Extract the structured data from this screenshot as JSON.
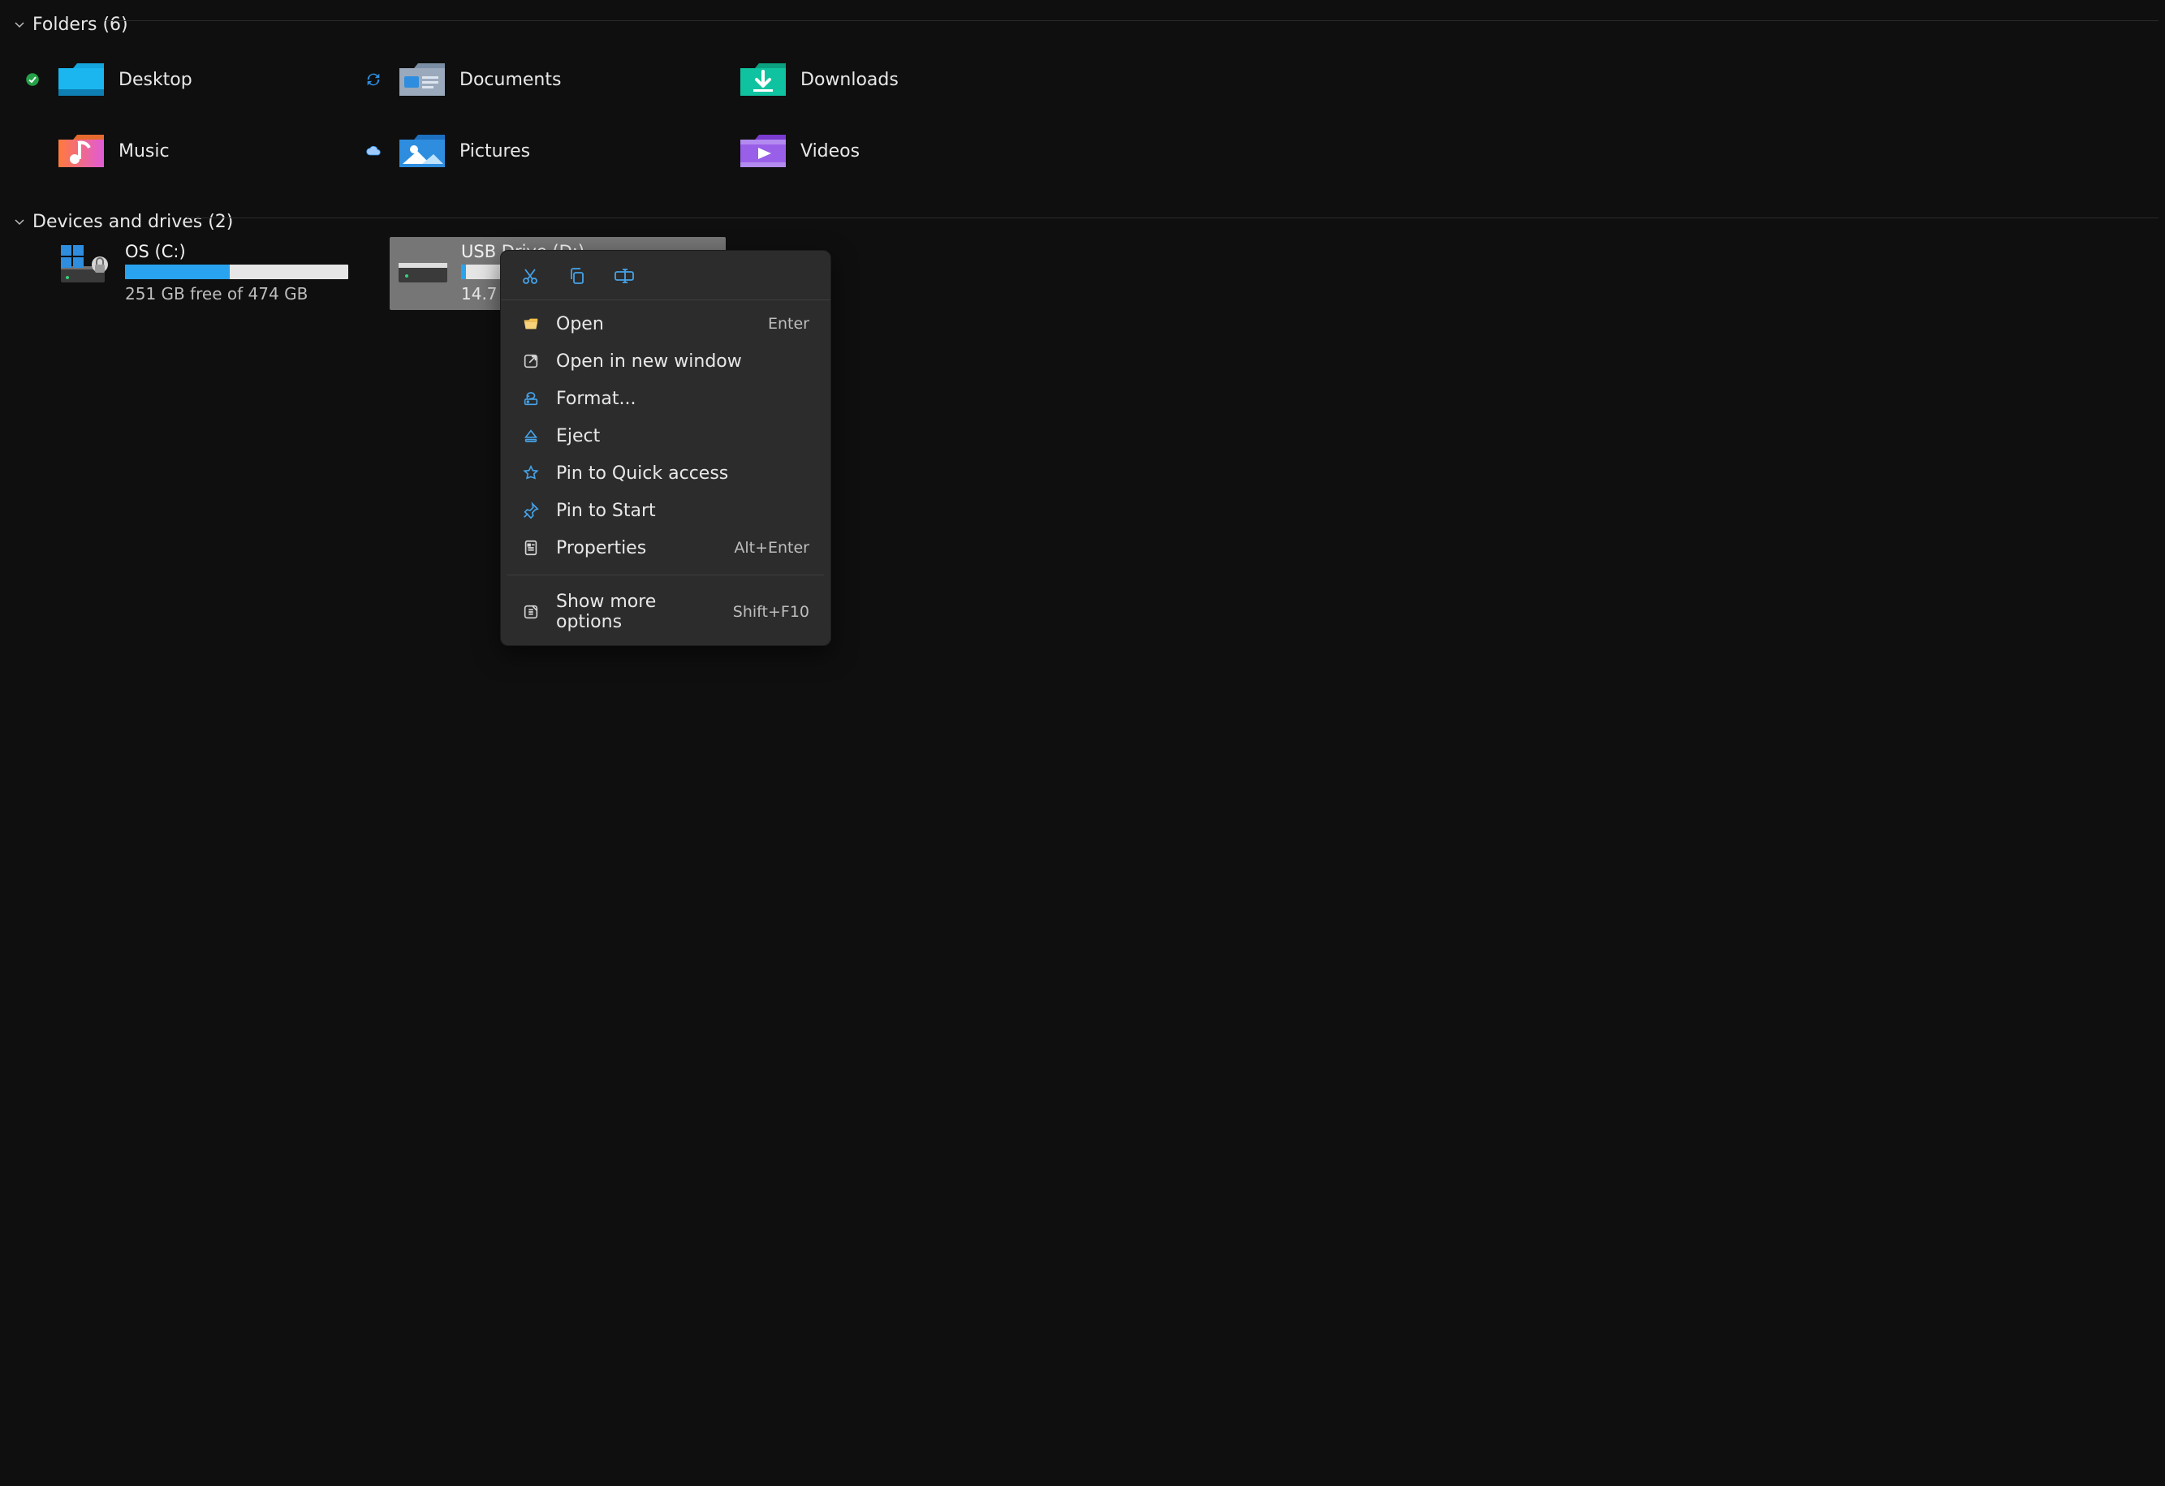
{
  "colors": {
    "accent": "#1c9bf0"
  },
  "groups": {
    "folders": {
      "title": "Folders (6)"
    },
    "drives": {
      "title": "Devices and drives (2)"
    }
  },
  "folders": [
    {
      "label": "Desktop",
      "status": "synced"
    },
    {
      "label": "Documents",
      "status": "syncing"
    },
    {
      "label": "Downloads",
      "status": "none"
    },
    {
      "label": "Music",
      "status": "none"
    },
    {
      "label": "Pictures",
      "status": "cloud"
    },
    {
      "label": "Videos",
      "status": "none"
    }
  ],
  "drives": [
    {
      "title": "OS (C:)",
      "sub": "251 GB free of 474 GB",
      "fill_pct": 47,
      "selected": false,
      "kind": "os"
    },
    {
      "title": "USB Drive (D:)",
      "sub": "14.7",
      "fill_pct": 2,
      "selected": true,
      "kind": "usb"
    }
  ],
  "context_menu": {
    "quick_actions": [
      "cut",
      "copy",
      "rename"
    ],
    "items": [
      {
        "icon": "folder-open",
        "label": "Open",
        "accel": "Enter"
      },
      {
        "icon": "open-external",
        "label": "Open in new window",
        "accel": ""
      },
      {
        "icon": "format-drive",
        "label": "Format...",
        "accel": ""
      },
      {
        "icon": "eject",
        "label": "Eject",
        "accel": ""
      },
      {
        "icon": "star",
        "label": "Pin to Quick access",
        "accel": ""
      },
      {
        "icon": "pin",
        "label": "Pin to Start",
        "accel": ""
      },
      {
        "icon": "properties",
        "label": "Properties",
        "accel": "Alt+Enter"
      }
    ],
    "more": {
      "icon": "more-options",
      "label": "Show more options",
      "accel": "Shift+F10"
    }
  }
}
